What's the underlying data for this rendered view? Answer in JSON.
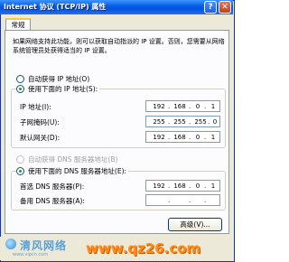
{
  "window": {
    "title": "Internet 协议 (TCP/IP) 属性",
    "help_btn": "?",
    "close_btn": "✕"
  },
  "tabs": [
    {
      "label": "常规"
    }
  ],
  "info_text": "如果网络支持此功能，则可以获取自动指派的 IP 设置。否则，您需要从网络系统管理员处获得适当的 IP 设置。",
  "ip_section": {
    "auto_label": "自动获得 IP 地址(O)",
    "manual_label": "使用下面的 IP 地址(S):",
    "selected": "manual",
    "fields": [
      {
        "label": "IP 地址(I):",
        "octets": [
          "192",
          "168",
          "0",
          "1"
        ]
      },
      {
        "label": "子网掩码(U):",
        "octets": [
          "255",
          "255",
          "255",
          "0"
        ]
      },
      {
        "label": "默认网关(D):",
        "octets": [
          "192",
          "168",
          "0",
          "1"
        ]
      }
    ]
  },
  "dns_section": {
    "auto_label": "自动获得 DNS 服务器地址(B)",
    "manual_label": "使用下面的 DNS 服务器地址(E):",
    "selected": "manual",
    "fields": [
      {
        "label": "首选 DNS 服务器(P):",
        "octets": [
          "192",
          "168",
          "0",
          "1"
        ]
      },
      {
        "label": "备用 DNS 服务器(A):",
        "octets": [
          "",
          "",
          "",
          ""
        ]
      }
    ]
  },
  "advanced_button": "高级(V)...",
  "footer": {
    "logo_text": "清风网络",
    "logo_sub": "www.vipcn.com",
    "watermark": "www.qz26.com"
  },
  "colors": {
    "titlebar": "#0054e3",
    "dialog_bg": "#ece9d8",
    "radio_dot": "#21a121",
    "watermark": "#ff8c1a"
  }
}
